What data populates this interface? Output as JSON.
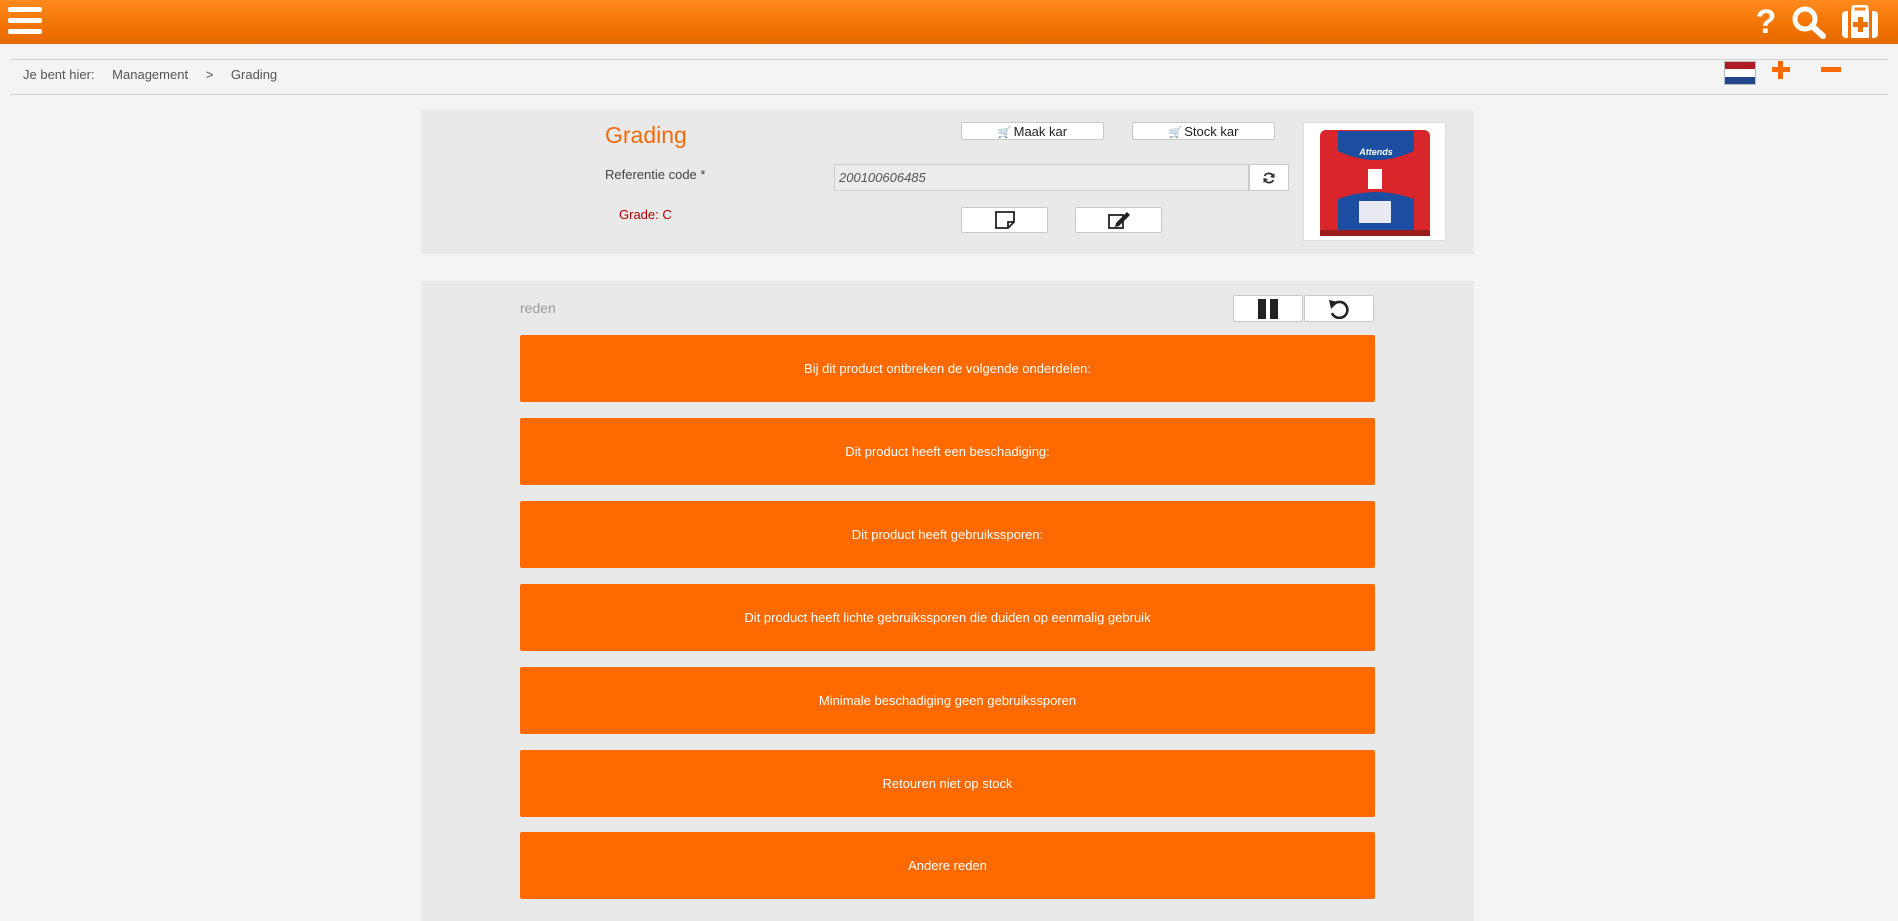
{
  "header": {
    "menu_icon": "hamburger-menu-icon",
    "help_icon": "question-icon",
    "help_glyph": "?",
    "search_icon": "search-icon",
    "kit_icon": "first-aid-kit-icon"
  },
  "breadcrumb": {
    "prefix": "Je bent hier:",
    "items": [
      "Management",
      "Grading"
    ],
    "separator": ">"
  },
  "language": {
    "flag": "nl-flag-icon",
    "colors": [
      "#ae1c28",
      "#ffffff",
      "#21468b"
    ]
  },
  "zoom": {
    "plus_icon": "plus-icon",
    "minus_icon": "minus-icon"
  },
  "grading": {
    "title": "Grading",
    "maak_kar": "Maak kar",
    "stock_kar": "Stock kar",
    "cart_icon": "cart-icon",
    "ref_label": "Referentie code *",
    "ref_value": "200100606485",
    "refresh_icon": "refresh-icon",
    "grade_text": "Grade: C",
    "note_icon": "note-icon",
    "edit_icon": "edit-icon",
    "product_image": "product-image",
    "product_brand": "Attends"
  },
  "reasons": {
    "label": "reden",
    "pause_icon": "pause-icon",
    "undo_icon": "undo-icon",
    "items": [
      "Bij dit product ontbreken de volgende onderdelen:",
      "Dit product heeft een beschadiging:",
      "Dit product heeft gebruikssporen:",
      "Dit product heeft lichte gebruikssporen die duiden op eenmalig gebruik",
      "Minimale beschadiging geen gebruikssporen",
      "Retouren niet op stock",
      "Andere reden"
    ]
  },
  "colors": {
    "accent": "#ff6a00",
    "title": "#f26b0a",
    "grade": "#b00000"
  }
}
